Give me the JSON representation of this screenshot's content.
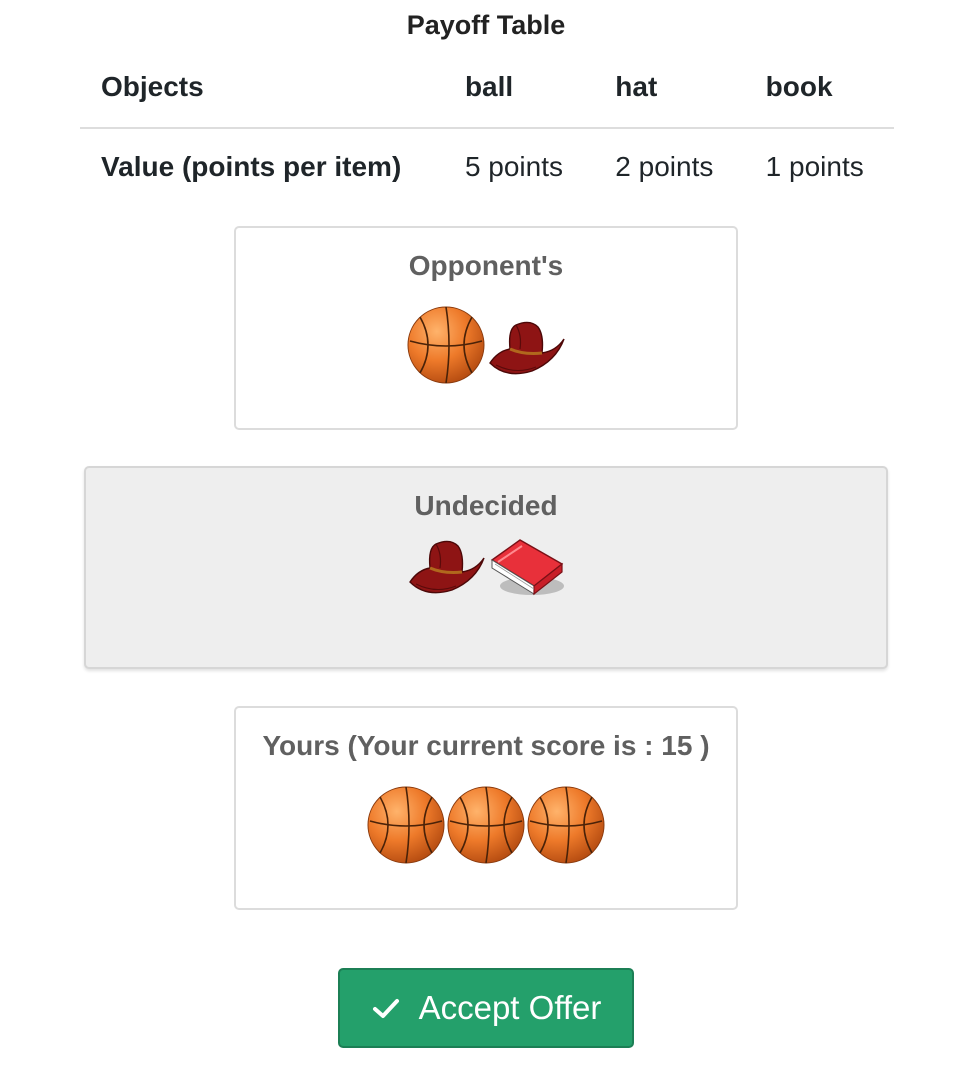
{
  "payoff_table": {
    "title": "Payoff Table",
    "header": {
      "label": "Objects",
      "columns": [
        "ball",
        "hat",
        "book"
      ]
    },
    "row": {
      "label": "Value (points per item)",
      "values": [
        "5 points",
        "2 points",
        "1 points"
      ]
    }
  },
  "panels": {
    "opponent": {
      "title": "Opponent's",
      "items": [
        "ball",
        "hat"
      ]
    },
    "undecided": {
      "title": "Undecided",
      "items": [
        "hat",
        "book"
      ]
    },
    "yours": {
      "title": "Yours (Your current score is : 15 )",
      "items": [
        "ball",
        "ball",
        "ball"
      ]
    }
  },
  "accept_button": {
    "label": "Accept Offer",
    "icon": "checkmark-icon"
  },
  "colors": {
    "button_green": "#24a06b",
    "undecided_bg": "#eeeeee",
    "panel_title": "#606060"
  }
}
